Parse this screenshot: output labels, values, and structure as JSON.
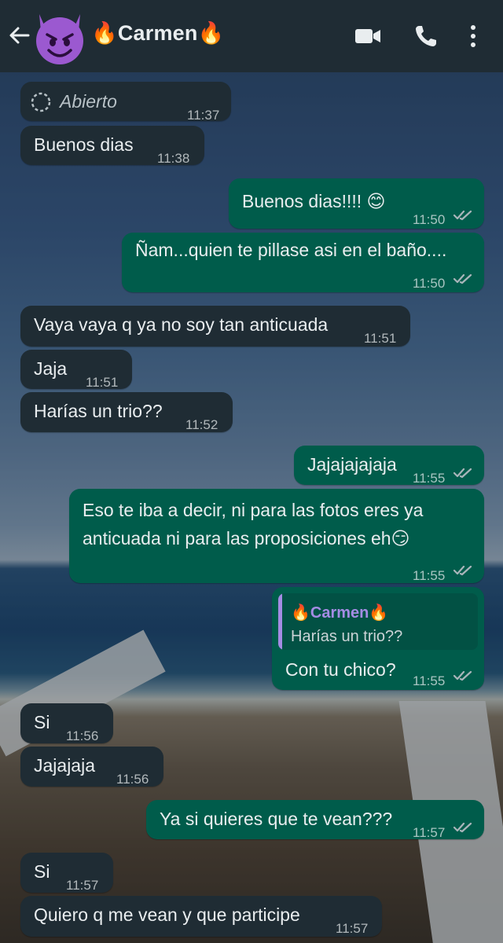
{
  "header": {
    "contact_name": "🔥Carmen🔥",
    "avatar_emoji": "😈",
    "icons": [
      "back-arrow-icon",
      "video-call-icon",
      "phone-icon",
      "more-options-icon"
    ]
  },
  "messages": [
    {
      "direction": "in",
      "text": "Abierto",
      "time": "11:37",
      "type": "view-once-opened"
    },
    {
      "direction": "in",
      "text": "Buenos dias",
      "time": "11:38"
    },
    {
      "direction": "out",
      "text": "Buenos dias!!!! 😊",
      "time": "11:50",
      "read": true
    },
    {
      "direction": "out",
      "text": "Ñam...quien te pillase asi en el baño....",
      "time": "11:50",
      "read": true
    },
    {
      "direction": "in",
      "text": "Vaya vaya q ya no soy tan anticuada",
      "time": "11:51"
    },
    {
      "direction": "in",
      "text": "Jaja",
      "time": "11:51"
    },
    {
      "direction": "in",
      "text": "Harías un trio??",
      "time": "11:52"
    },
    {
      "direction": "out",
      "text": "Jajajajajaja",
      "time": "11:55",
      "read": true
    },
    {
      "direction": "out",
      "text_lines": [
        "Eso te iba a decir, ni para las fotos eres ya",
        "anticuada ni para las proposiciones eh😏"
      ],
      "time": "11:55",
      "read": true
    },
    {
      "direction": "out",
      "quoted_name": "🔥Carmen🔥",
      "quoted_text": "Harías un trio??",
      "text": "Con tu chico?",
      "time": "11:55",
      "read": true
    },
    {
      "direction": "in",
      "text": "Si",
      "time": "11:56"
    },
    {
      "direction": "in",
      "text": "Jajajaja",
      "time": "11:56"
    },
    {
      "direction": "out",
      "text": "Ya si quieres que te vean???",
      "time": "11:57",
      "read": true
    },
    {
      "direction": "in",
      "text": "Si",
      "time": "11:57"
    },
    {
      "direction": "in",
      "text": "Quiero q me vean y que participe",
      "time": "11:57"
    }
  ],
  "colors": {
    "header_bg": "#1f2c34",
    "incoming_bubble": "#1f2c34",
    "outgoing_bubble": "#005c4b",
    "quote_accent": "#a58ce4",
    "text": "#e9edef"
  }
}
